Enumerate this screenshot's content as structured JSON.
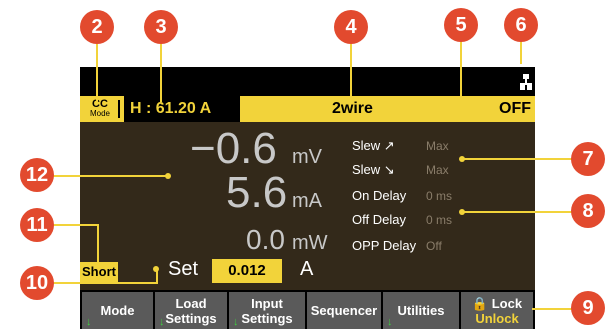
{
  "status_bar": {
    "mode_line1": "CC",
    "mode_line2": "Mode",
    "limit": "H : 61.20 A",
    "wire": "2wire",
    "output_state": "OFF"
  },
  "readings": {
    "voltage_value": "−0.6",
    "voltage_unit": "mV",
    "current_value": "5.6",
    "current_unit": "mA",
    "power_value": "0.0",
    "power_unit": "mW"
  },
  "settings_list": [
    {
      "label": "Slew ↗",
      "value": "Max"
    },
    {
      "label": "Slew ↘",
      "value": "Max"
    },
    {
      "label": "On  Delay",
      "value": "0 ms"
    },
    {
      "label": "Off  Delay",
      "value": "0 ms"
    },
    {
      "label": "OPP Delay",
      "value": "Off"
    }
  ],
  "short_label": "Short",
  "set": {
    "label": "Set",
    "value": "0.012",
    "unit": "A"
  },
  "softkeys": [
    {
      "line1": "Mode",
      "line2": ""
    },
    {
      "line1": "Load",
      "line2": "Settings"
    },
    {
      "line1": "Input",
      "line2": "Settings"
    },
    {
      "line1": "Sequencer",
      "line2": ""
    },
    {
      "line1": "Utilities",
      "line2": ""
    },
    {
      "line1": "🔒 Lock",
      "line2": "Unlock"
    }
  ],
  "callouts": [
    "2",
    "3",
    "4",
    "5",
    "6",
    "7",
    "8",
    "9",
    "10",
    "11",
    "12"
  ],
  "colors": {
    "accent": "#f2d33a",
    "callout": "#e24a2e",
    "panel": "#33291a"
  }
}
